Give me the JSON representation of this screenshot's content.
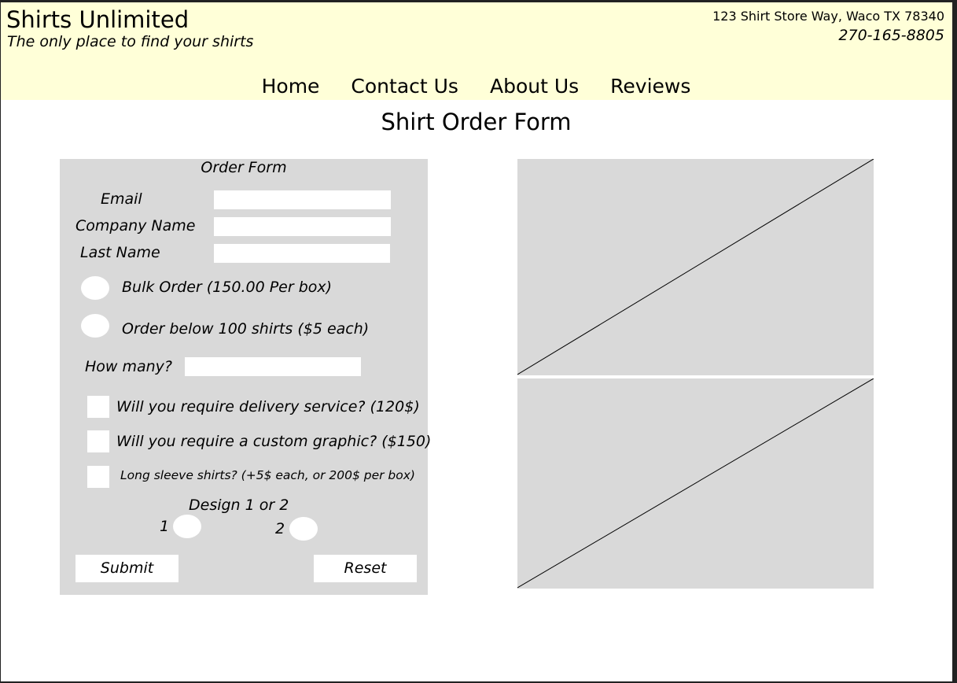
{
  "header": {
    "brand": "Shirts Unlimited",
    "tagline": "The only place to find your shirts",
    "address": "123 Shirt Store Way, Waco TX 78340",
    "phone": "270-165-8805",
    "bg_color": "#ffffd8"
  },
  "nav": {
    "items": [
      {
        "label": "Home"
      },
      {
        "label": "Contact Us"
      },
      {
        "label": "About Us"
      },
      {
        "label": "Reviews"
      }
    ]
  },
  "page": {
    "title": "Shirt Order Form"
  },
  "form": {
    "heading": "Order Form",
    "email_label": "Email",
    "email_value": "",
    "company_label": "Company Name",
    "company_value": "",
    "lastname_label": "Last Name",
    "lastname_value": "",
    "bulk_label": "Bulk Order (150.00 Per box)",
    "below100_label": "Order below 100 shirts ($5 each)",
    "howmany_label": "How many?",
    "howmany_value": "",
    "delivery_label": "Will you require delivery service? (120$)",
    "graphic_label": "Will you require a custom graphic? ($150)",
    "longsleeve_label": "Long sleeve shirts? (+5$ each, or 200$ per box)",
    "design_label": "Design 1 or 2",
    "design1_label": "1",
    "design2_label": "2",
    "submit_label": "Submit",
    "reset_label": "Reset",
    "panel_color": "#d9d9d9"
  }
}
